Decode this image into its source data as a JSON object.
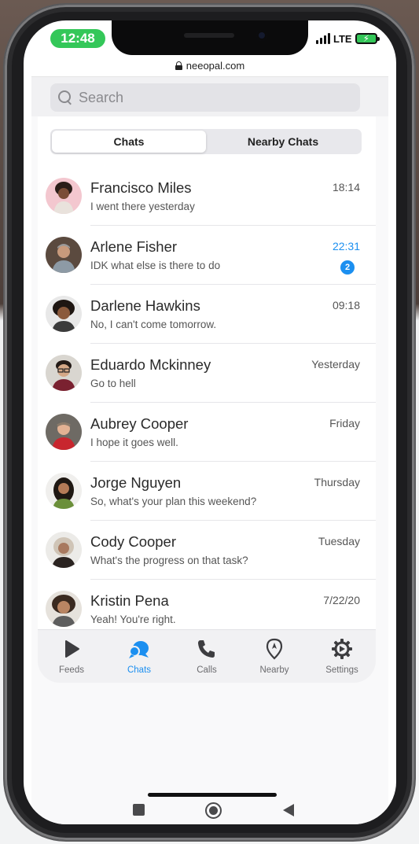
{
  "status_bar": {
    "time": "12:48",
    "network": "LTE"
  },
  "browser": {
    "url": "neeopal.com"
  },
  "search": {
    "placeholder": "Search"
  },
  "segments": [
    {
      "label": "Chats",
      "active": true
    },
    {
      "label": "Nearby Chats",
      "active": false
    }
  ],
  "chats": [
    {
      "name": "Francisco Miles",
      "message": "I went there yesterday",
      "time": "18:14",
      "unread": null
    },
    {
      "name": "Arlene Fisher",
      "message": "IDK what else is there to do",
      "time": "22:31",
      "unread": "2"
    },
    {
      "name": "Darlene Hawkins",
      "message": "No, I can't come tomorrow.",
      "time": "09:18",
      "unread": null
    },
    {
      "name": "Eduardo Mckinney",
      "message": "Go to hell",
      "time": "Yesterday",
      "unread": null
    },
    {
      "name": "Aubrey Cooper",
      "message": "I hope it goes well.",
      "time": "Friday",
      "unread": null
    },
    {
      "name": "Jorge Nguyen",
      "message": "So, what's your plan this weekend?",
      "time": "Thursday",
      "unread": null
    },
    {
      "name": "Cody Cooper",
      "message": "What's the progress on that task?",
      "time": "Tuesday",
      "unread": null
    },
    {
      "name": "Kristin Pena",
      "message": "Yeah! You're right.",
      "time": "7/22/20",
      "unread": null
    }
  ],
  "tab_bar": [
    {
      "label": "Feeds",
      "icon": "play-icon",
      "active": false
    },
    {
      "label": "Chats",
      "icon": "chat-bubbles-icon",
      "active": true
    },
    {
      "label": "Calls",
      "icon": "phone-icon",
      "active": false
    },
    {
      "label": "Nearby",
      "icon": "location-pin-icon",
      "active": false
    },
    {
      "label": "Settings",
      "icon": "gear-icon",
      "active": false
    }
  ],
  "colors": {
    "accent": "#1b8ff0",
    "status_pill": "#34c759",
    "text_primary": "#2a2a2a",
    "text_secondary": "#555555"
  }
}
